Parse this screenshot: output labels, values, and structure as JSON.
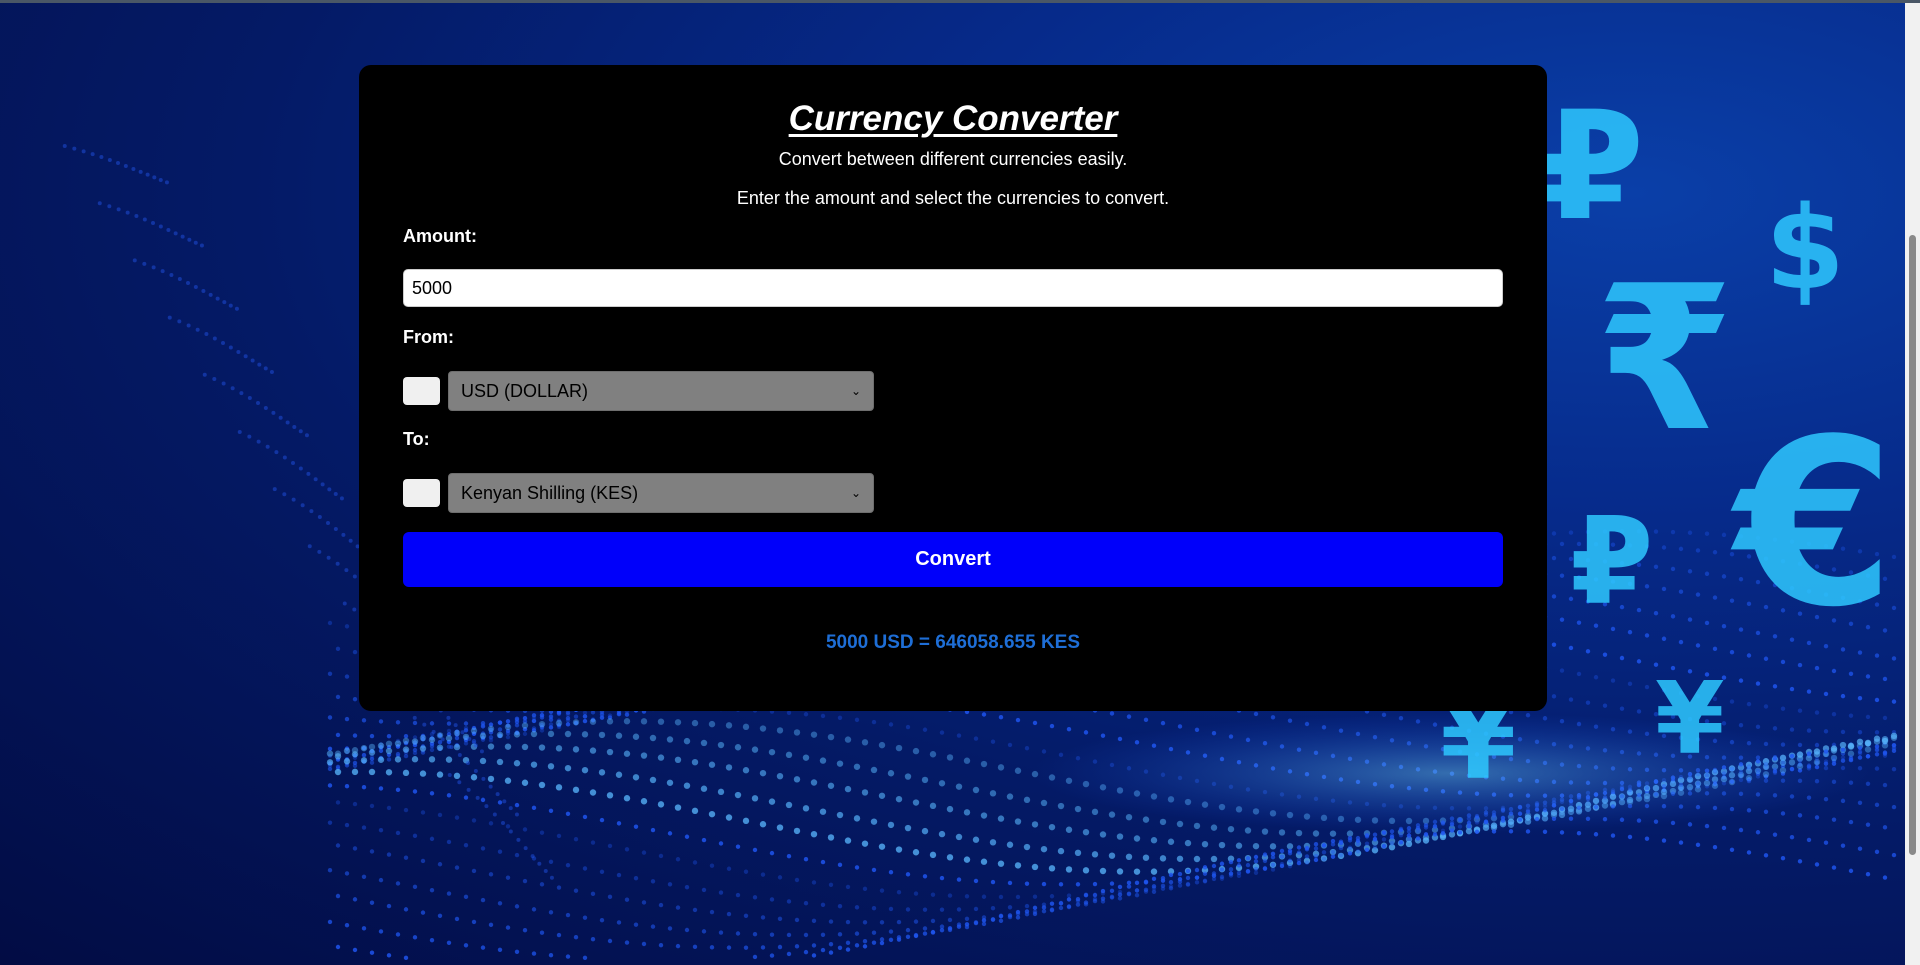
{
  "app": {
    "title": "Currency Converter",
    "subtitle": "Convert between different currencies easily.",
    "instructions": "Enter the amount and select the currencies to convert."
  },
  "form": {
    "amount_label": "Amount:",
    "amount_value": "5000",
    "from_label": "From:",
    "from_selected": "USD (DOLLAR)",
    "to_label": "To:",
    "to_selected": "Kenyan Shilling (KES)",
    "convert_label": "Convert"
  },
  "result": {
    "text": "5000 USD = 646058.655 KES"
  },
  "background": {
    "symbols": [
      "₽",
      "$",
      "₹",
      "€",
      "₽",
      "¥",
      "¥"
    ]
  },
  "colors": {
    "card": "#000000",
    "button": "#0000fa",
    "result": "#1e6ed6",
    "select": "#808080"
  }
}
